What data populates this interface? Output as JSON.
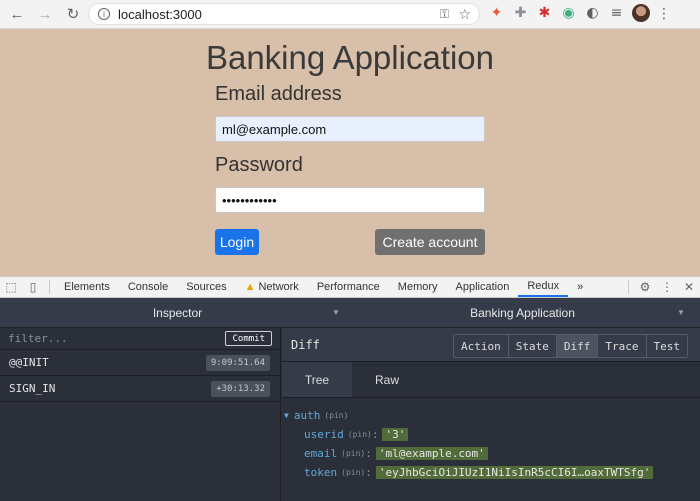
{
  "browser": {
    "url": "localhost:3000",
    "info_glyph": "i",
    "extensions": [
      {
        "name": "ext-rocket-icon",
        "glyph": "✦",
        "color": "#e85c3a"
      },
      {
        "name": "ext-puzzle-icon",
        "glyph": "✚",
        "color": "#8b9096"
      },
      {
        "name": "ext-red-tool-icon",
        "glyph": "✱",
        "color": "#d22f2f"
      },
      {
        "name": "ext-green-circle-icon",
        "glyph": "◉",
        "color": "#3fb07a"
      },
      {
        "name": "ext-devtools-icon",
        "glyph": "◐",
        "color": "#5f6368"
      },
      {
        "name": "ext-media-icon",
        "glyph": "≡",
        "color": "#5f6368"
      }
    ]
  },
  "app": {
    "title": "Banking Application",
    "email_label": "Email address",
    "email_value": "ml@example.com",
    "password_label": "Password",
    "password_value": "••••••••••••",
    "login_label": "Login",
    "create_label": "Create account"
  },
  "devtools": {
    "tabs": [
      {
        "label": "Elements"
      },
      {
        "label": "Console"
      },
      {
        "label": "Sources"
      },
      {
        "label": "Network",
        "warning": true
      },
      {
        "label": "Performance"
      },
      {
        "label": "Memory"
      },
      {
        "label": "Application"
      },
      {
        "label": "Redux",
        "active": true
      }
    ],
    "more": "»"
  },
  "redux": {
    "inspector_label": "Inspector",
    "app_name": "Banking Application",
    "filter_placeholder": "filter...",
    "commit_label": "Commit",
    "actions": [
      {
        "name": "@@INIT",
        "time": "9:09:51.64"
      },
      {
        "name": "SIGN_IN",
        "time": "+30:13.32"
      }
    ],
    "diff_label": "Diff",
    "monitor_buttons": [
      {
        "label": "Action"
      },
      {
        "label": "State"
      },
      {
        "label": "Diff",
        "active": true
      },
      {
        "label": "Trace"
      },
      {
        "label": "Test"
      }
    ],
    "view_tabs": [
      {
        "label": "Tree",
        "active": true
      },
      {
        "label": "Raw"
      }
    ],
    "tree": {
      "root_key": "auth",
      "pin": "(pin)",
      "entries": [
        {
          "key": "userid",
          "value": "'3'"
        },
        {
          "key": "email",
          "value": "'ml@example.com'"
        },
        {
          "key": "token",
          "value": "'eyJhbGciOiJIUzI1NiIsInR5cCI6I…oaxTWTSfg'"
        }
      ]
    }
  }
}
